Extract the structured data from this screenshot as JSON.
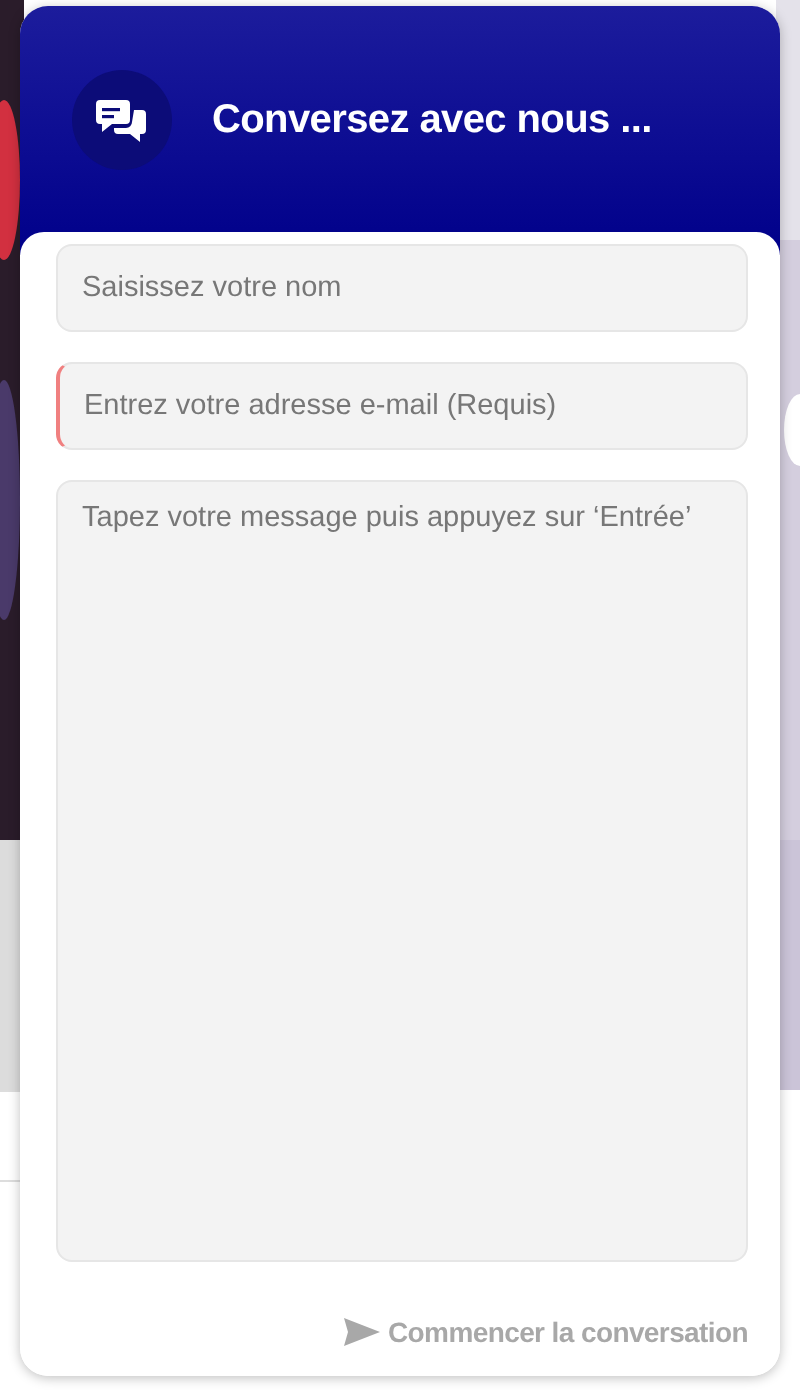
{
  "header": {
    "title": "Conversez avec nous ..."
  },
  "fields": [
    {
      "kind": "input",
      "placeholder": "Saisissez votre nom",
      "error": false
    },
    {
      "kind": "input",
      "placeholder": "Entrez votre adresse e-mail (Requis)",
      "error": true
    },
    {
      "kind": "textarea",
      "placeholder": "Tapez votre message puis appuyez sur ‘Entrée’",
      "error": false
    }
  ],
  "submit": {
    "label": "Commencer la conversation",
    "disabled": true
  }
}
